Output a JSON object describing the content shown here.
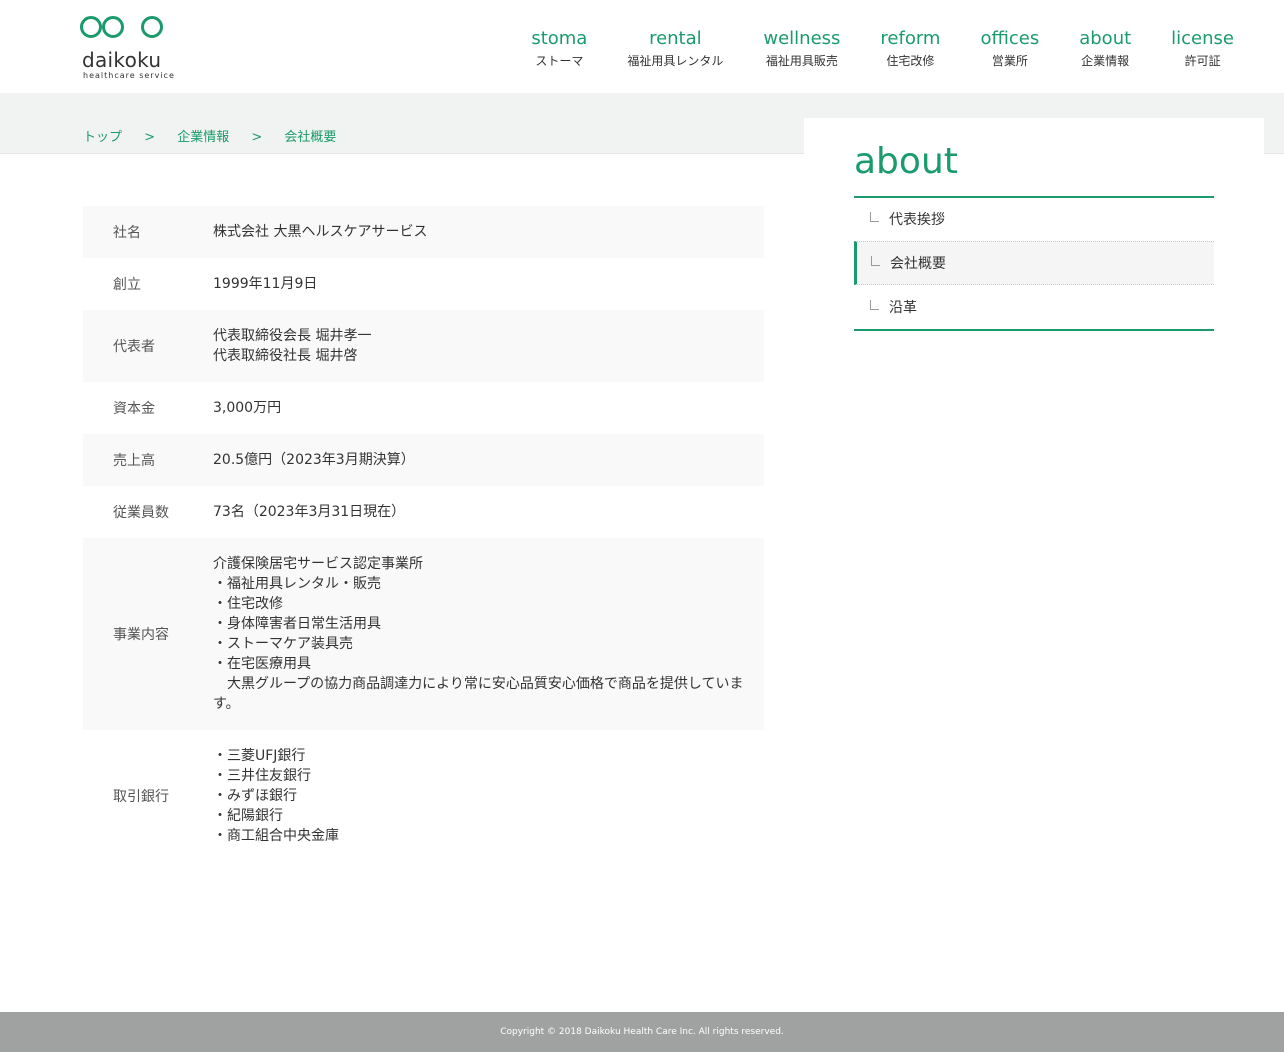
{
  "brand": {
    "name": "daikoku",
    "tagline": "healthcare service",
    "accent_color": "#1a9b6c"
  },
  "nav": [
    {
      "en": "stoma",
      "ja": "ストーマ"
    },
    {
      "en": "rental",
      "ja": "福祉用具レンタル"
    },
    {
      "en": "wellness",
      "ja": "福祉用具販売"
    },
    {
      "en": "reform",
      "ja": "住宅改修"
    },
    {
      "en": "offices",
      "ja": "営業所"
    },
    {
      "en": "about",
      "ja": "企業情報"
    },
    {
      "en": "license",
      "ja": "許可証"
    }
  ],
  "breadcrumb": {
    "items": [
      "トップ",
      "企業情報",
      "会社概要"
    ],
    "separator": ">"
  },
  "company_info": [
    {
      "label": "社名",
      "value": "株式会社 大黒ヘルスケアサービス"
    },
    {
      "label": "創立",
      "value": "1999年11月9日"
    },
    {
      "label": "代表者",
      "value": "代表取締役会長 堀井孝一\n代表取締役社長 堀井啓"
    },
    {
      "label": "資本金",
      "value": "3,000万円"
    },
    {
      "label": "売上高",
      "value": "20.5億円（2023年3月期決算）"
    },
    {
      "label": "従業員数",
      "value": "73名（2023年3月31日現在）"
    },
    {
      "label": "事業内容",
      "value": "介護保険居宅サービス認定事業所\n・福祉用具レンタル・販売\n・住宅改修\n・身体障害者日常生活用具\n・ストーマケア装具売\n・在宅医療用具\n　大黒グループの協力商品調達力により常に安心品質安心価格で商品を提供しています。"
    },
    {
      "label": "取引銀行",
      "value": "・三菱UFJ銀行\n・三井住友銀行\n・みずほ銀行\n・紀陽銀行\n・商工組合中央金庫"
    }
  ],
  "sidebar": {
    "title": "about",
    "items": [
      {
        "label": "代表挨拶",
        "active": false
      },
      {
        "label": "会社概要",
        "active": true
      },
      {
        "label": "沿革",
        "active": false
      }
    ]
  },
  "footer": {
    "copyright": "Copyright © 2018 Daikoku Health Care Inc. All rights reserved."
  }
}
